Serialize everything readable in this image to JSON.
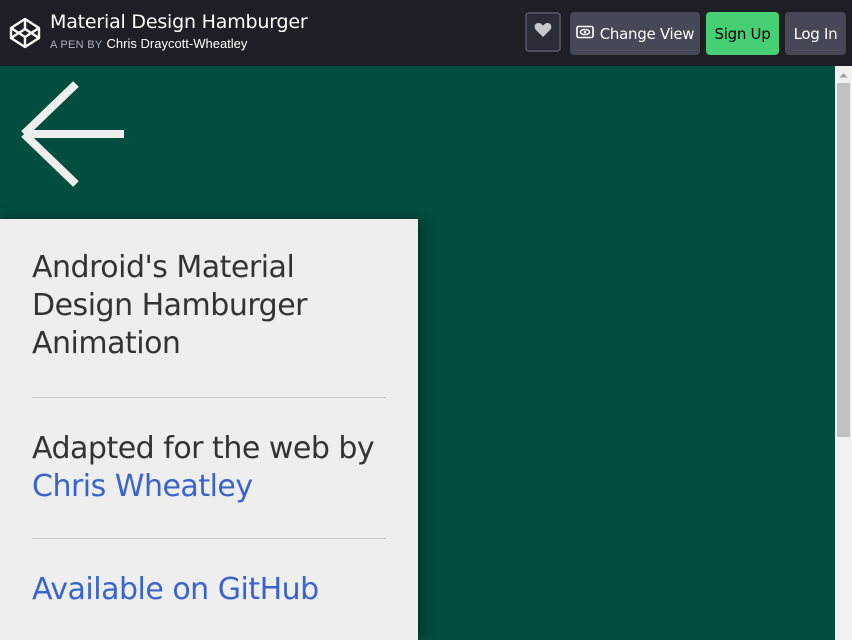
{
  "header": {
    "title": "Material Design Hamburger",
    "byline_prefix": "A PEN BY",
    "author": "Chris Draycott-Wheatley",
    "change_view_label": "Change View",
    "sign_up_label": "Sign Up",
    "log_in_label": "Log In"
  },
  "card": {
    "heading": "Android's Material Design Hamburger Animation",
    "adapted_prefix": "Adapted for the web by",
    "adapted_author": "Chris Wheatley",
    "github_link": "Available on GitHub"
  },
  "colors": {
    "topbar": "#1e1f26",
    "background": "#014d3e",
    "card": "#eeeeee",
    "link": "#3a64cc",
    "sign_up": "#47cf73"
  },
  "icons": [
    "codepen-logo-icon",
    "heart-icon",
    "eye-icon",
    "back-arrow-icon",
    "scroll-up-arrow-icon"
  ]
}
